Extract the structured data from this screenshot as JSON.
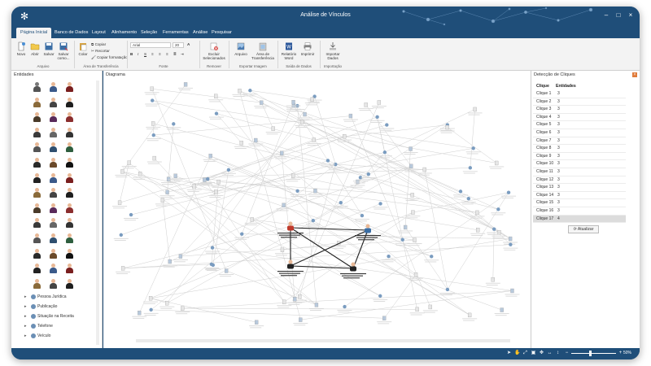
{
  "window": {
    "title": "Análise de Vínculos",
    "controls": [
      "–",
      "□",
      "×"
    ]
  },
  "tabs": [
    "Página Inicial",
    "Banco de Dados",
    "Layout",
    "Alinhamento",
    "Seleção",
    "Ferramentas",
    "Análise",
    "Pesquisar"
  ],
  "ribbon": {
    "file_buttons": [
      "Novo",
      "Abrir",
      "Salvar",
      "Salvar como..."
    ],
    "file_group": "Arquivo",
    "clipboard_main": "Colar",
    "clipboard_items": [
      "Copiar",
      "Recortar",
      "Copiar formatação"
    ],
    "clipboard_group": "Área de Transferência",
    "font_name": "Arial",
    "font_size": "20",
    "font_group": "Fonte",
    "remove_button": "Excluir Selecionados",
    "remove_group": "Remover",
    "export_buttons": [
      "Arquivo",
      "Área de Transferência"
    ],
    "export_group": "Exportar Imagem",
    "output_buttons": [
      "Relatório Word",
      "Imprimir"
    ],
    "output_group": "Saída de Dados",
    "import_button": "Importar Dados",
    "import_group": "Importação"
  },
  "left_panel": {
    "title": "Entidades",
    "tree": [
      "Pessoa Jurídica",
      "Publicação",
      "Situação na Receita",
      "Telefone",
      "Veículo"
    ]
  },
  "diagram": {
    "title": "Diagrama"
  },
  "right_panel": {
    "title": "Detecção de Cliques",
    "headers": [
      "Clique",
      "Entidades"
    ],
    "rows": [
      {
        "name": "Clique 1",
        "count": "3"
      },
      {
        "name": "Clique 2",
        "count": "3"
      },
      {
        "name": "Clique 3",
        "count": "3"
      },
      {
        "name": "Clique 4",
        "count": "3"
      },
      {
        "name": "Clique 5",
        "count": "3"
      },
      {
        "name": "Clique 6",
        "count": "3"
      },
      {
        "name": "Clique 7",
        "count": "3"
      },
      {
        "name": "Clique 8",
        "count": "3"
      },
      {
        "name": "Clique 9",
        "count": "3"
      },
      {
        "name": "Clique 10",
        "count": "3"
      },
      {
        "name": "Clique 11",
        "count": "3"
      },
      {
        "name": "Clique 12",
        "count": "3"
      },
      {
        "name": "Clique 13",
        "count": "3"
      },
      {
        "name": "Clique 14",
        "count": "3"
      },
      {
        "name": "Clique 15",
        "count": "3"
      },
      {
        "name": "Clique 16",
        "count": "3"
      },
      {
        "name": "Clique 17",
        "count": "4"
      }
    ],
    "selected_row": "Clique 17",
    "update_button": "Atualizar"
  },
  "status": {
    "zoom": "50%"
  },
  "colors": {
    "chrome": "#1f4e79",
    "ribbon": "#f3f3f3",
    "selected_row": "#dcdcdc"
  }
}
